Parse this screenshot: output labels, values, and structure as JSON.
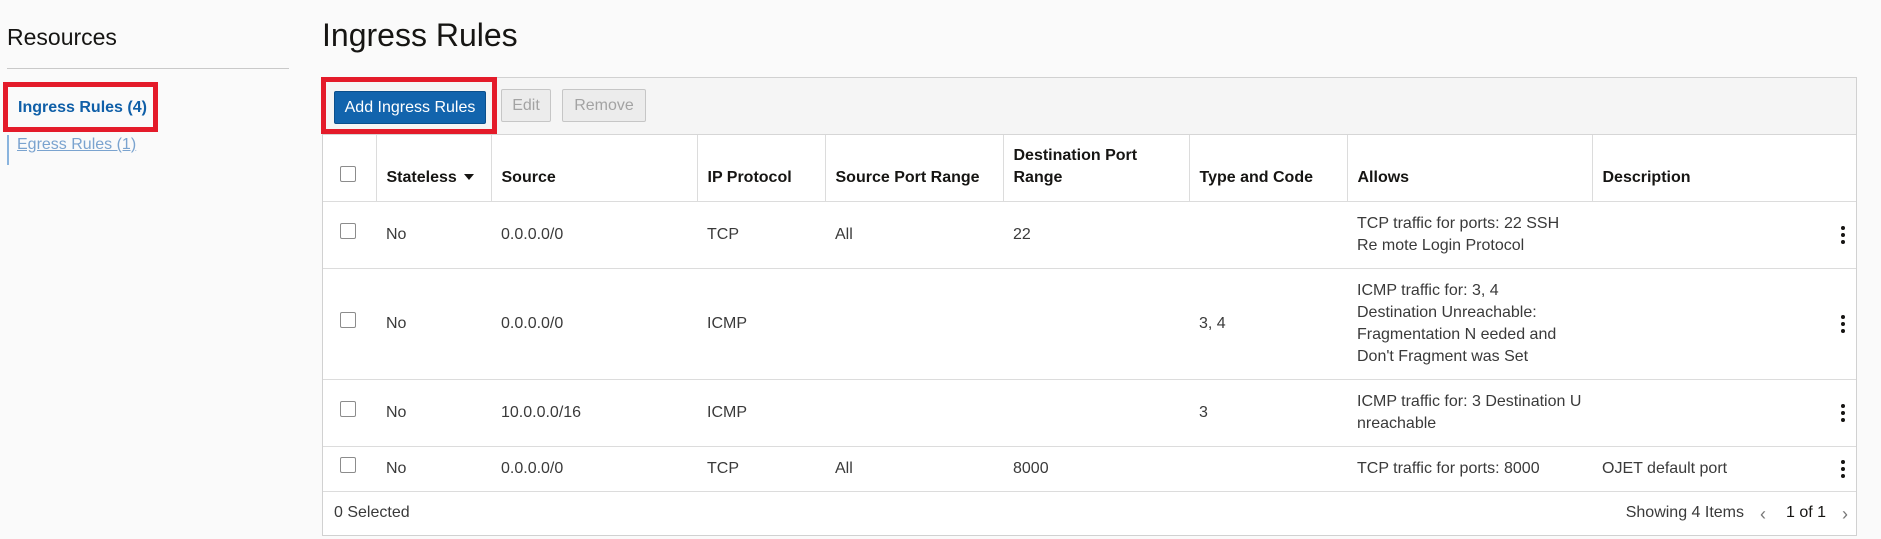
{
  "sidebar": {
    "title": "Resources",
    "items": [
      {
        "label": "Ingress Rules (4)"
      },
      {
        "label": "Egress Rules (1)"
      }
    ]
  },
  "main": {
    "title": "Ingress Rules",
    "toolbar": {
      "add_label": "Add Ingress Rules",
      "edit_label": "Edit",
      "remove_label": "Remove"
    },
    "columns": [
      "Stateless",
      "Source",
      "IP Protocol",
      "Source Port Range",
      "Destination Port Range",
      "Type and Code",
      "Allows",
      "Description"
    ],
    "rows": [
      {
        "stateless": "No",
        "source": "0.0.0.0/0",
        "protocol": "TCP",
        "src_port": "All",
        "dst_port": "22",
        "type_code": "",
        "allows": "TCP traffic for ports: 22 SSH Re mote Login Protocol",
        "description": ""
      },
      {
        "stateless": "No",
        "source": "0.0.0.0/0",
        "protocol": "ICMP",
        "src_port": "",
        "dst_port": "",
        "type_code": "3, 4",
        "allows": "ICMP traffic for: 3, 4 Destination Unreachable: Fragmentation N eeded and Don't Fragment was Set",
        "description": ""
      },
      {
        "stateless": "No",
        "source": "10.0.0.0/16",
        "protocol": "ICMP",
        "src_port": "",
        "dst_port": "",
        "type_code": "3",
        "allows": "ICMP traffic for: 3 Destination U nreachable",
        "description": ""
      },
      {
        "stateless": "No",
        "source": "0.0.0.0/0",
        "protocol": "TCP",
        "src_port": "All",
        "dst_port": "8000",
        "type_code": "",
        "allows": "TCP traffic for ports: 8000",
        "description": "OJET default port"
      }
    ],
    "footer": {
      "selected": "0 Selected",
      "showing": "Showing 4 Items",
      "page": "1 of 1"
    }
  },
  "colors": {
    "primary": "#1264ad",
    "link": "#0f5fa8",
    "highlight": "#e41b2a"
  }
}
